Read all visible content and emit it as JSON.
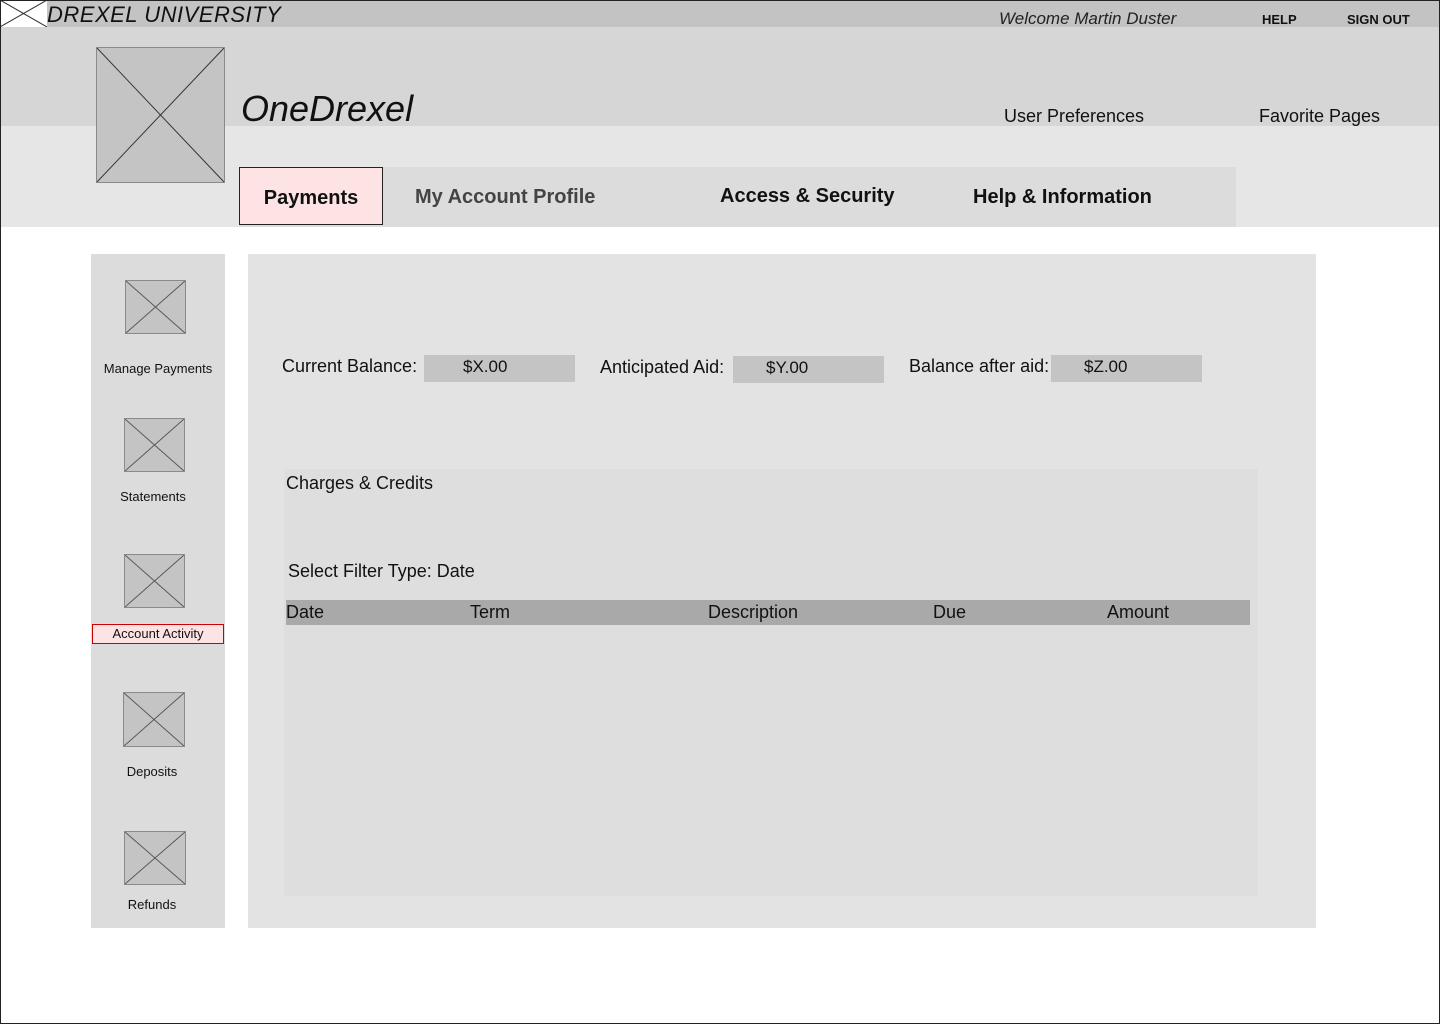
{
  "header": {
    "university": "DREXEL UNIVERSITY",
    "welcome": "Welcome Martin Duster",
    "help": "HELP",
    "sign_out": "SIGN OUT",
    "app_name": "OneDrexel",
    "user_preferences": "User Preferences",
    "favorite_pages": "Favorite Pages"
  },
  "tabs": [
    {
      "label": "Payments",
      "active": true
    },
    {
      "label": "My Account Profile",
      "active": false
    },
    {
      "label": "Access & Security",
      "active": false
    },
    {
      "label": "Help & Information",
      "active": false
    }
  ],
  "sidebar": {
    "items": [
      {
        "label": "Manage Payments",
        "icon": "image-placeholder-icon"
      },
      {
        "label": "Statements",
        "icon": "image-placeholder-icon"
      },
      {
        "label": "Account Activity",
        "icon": "image-placeholder-icon",
        "active": true
      },
      {
        "label": "Deposits",
        "icon": "image-placeholder-icon"
      },
      {
        "label": "Refunds",
        "icon": "image-placeholder-icon"
      }
    ]
  },
  "balances": {
    "current_label": "Current Balance:",
    "current_value": "$X.00",
    "aid_label": "Anticipated Aid:",
    "aid_value": "$Y.00",
    "after_label": "Balance after aid:",
    "after_value": "$Z.00"
  },
  "charges": {
    "title": "Charges & Credits",
    "filter": "Select Filter Type: Date",
    "columns": [
      "Date",
      "Term",
      "Description",
      "Due",
      "Amount"
    ],
    "rows": []
  },
  "colors": {
    "active_tab_bg": "#fde3e3",
    "placeholder": "#c4c4c4",
    "table_header": "#a9a9a9"
  }
}
